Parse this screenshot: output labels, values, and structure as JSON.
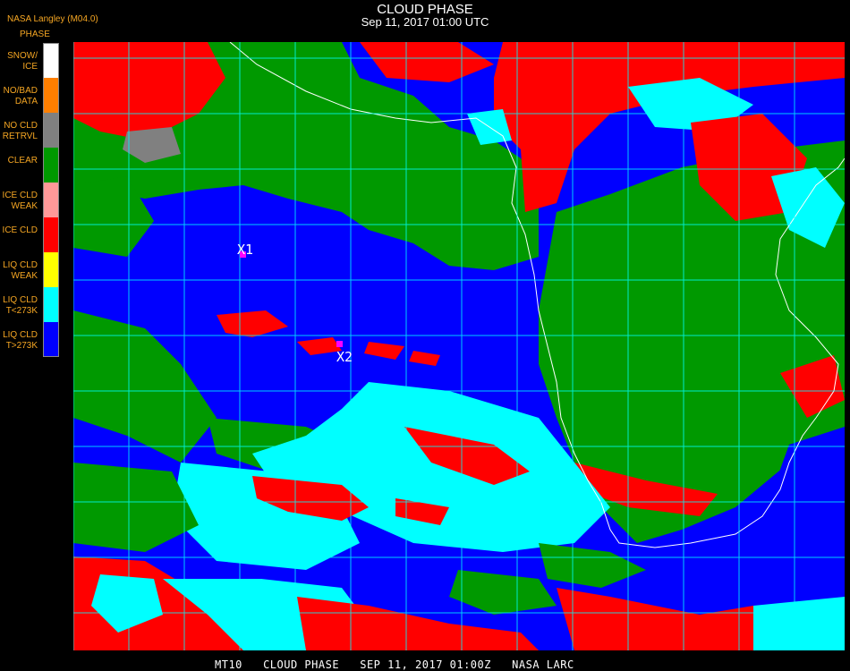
{
  "header": {
    "title": "CLOUD PHASE",
    "timestamp": "Sep 11, 2017 01:00 UTC",
    "producer": "NASA Langley (M04.0)"
  },
  "legend": {
    "heading": "PHASE",
    "items": [
      {
        "label": "SNOW/\nICE",
        "color": "#ffffff"
      },
      {
        "label": "NO/BAD\nDATA",
        "color": "#ff7f00"
      },
      {
        "label": "NO CLD\nRETRVL",
        "color": "#808080"
      },
      {
        "label": "CLEAR",
        "color": "#009900"
      },
      {
        "label": "ICE CLD\nWEAK",
        "color": "#ff9999"
      },
      {
        "label": "ICE CLD",
        "color": "#ff0000"
      },
      {
        "label": "LIQ CLD\nWEAK",
        "color": "#ffff00"
      },
      {
        "label": "LIQ CLD\nT<273K",
        "color": "#00ffff"
      },
      {
        "label": "LIQ CLD\nT>273K",
        "color": "#0000ff"
      }
    ]
  },
  "markers": [
    {
      "label": "X1",
      "color": "#ff00ff"
    },
    {
      "label": "X2",
      "color": "#ff00ff"
    }
  ],
  "grid_color": "#00ffff",
  "coastline_color": "#ffffff",
  "footer": "MT10   CLOUD PHASE   SEP 11, 2017 01:00Z   NASA LARC"
}
